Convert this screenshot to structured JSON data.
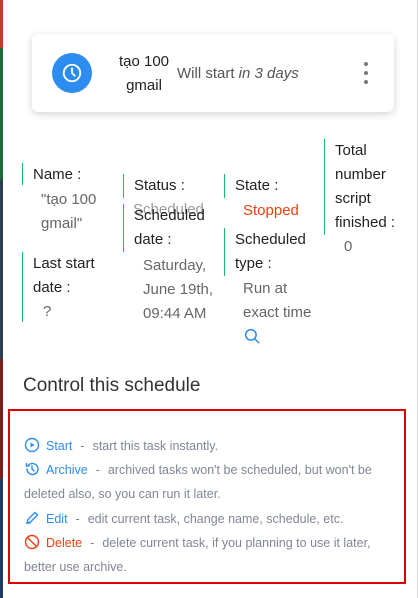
{
  "card": {
    "title": "tạo 100 gmail",
    "status_prefix": "Will start ",
    "status_em": "in 3 days"
  },
  "details": {
    "name_label": "Name :",
    "name_value": "\"tạo 100 gmail\"",
    "last_start_label": "Last start date :",
    "last_start_value": "?",
    "status_label": "Status :",
    "status_value": "Scheduled",
    "scheduled_date_label": "Scheduled date :",
    "scheduled_date_value": "Saturday, June 19th, 09:44 AM",
    "state_label": "State :",
    "state_value": "Stopped",
    "scheduled_type_label": "Scheduled type :",
    "scheduled_type_value": "Run at exact time",
    "total_label": "Total number script finished :",
    "total_value": "0"
  },
  "control": {
    "title": "Control this schedule",
    "items": [
      {
        "label": "Start",
        "desc": "start this task instantly."
      },
      {
        "label": "Archive",
        "desc": "archived tasks won't be scheduled, but won't be deleted also, so you can run it later."
      },
      {
        "label": "Edit",
        "desc": "edit current task, change name, schedule, etc."
      },
      {
        "label": "Delete",
        "desc": "delete current task, if you planning to use it later, better use archive."
      }
    ],
    "separator": "-"
  },
  "colors": {
    "accent": "#2d8cf0",
    "success_border": "#19be6b",
    "danger": "#ed4014",
    "highlight_box": "#e00000"
  }
}
